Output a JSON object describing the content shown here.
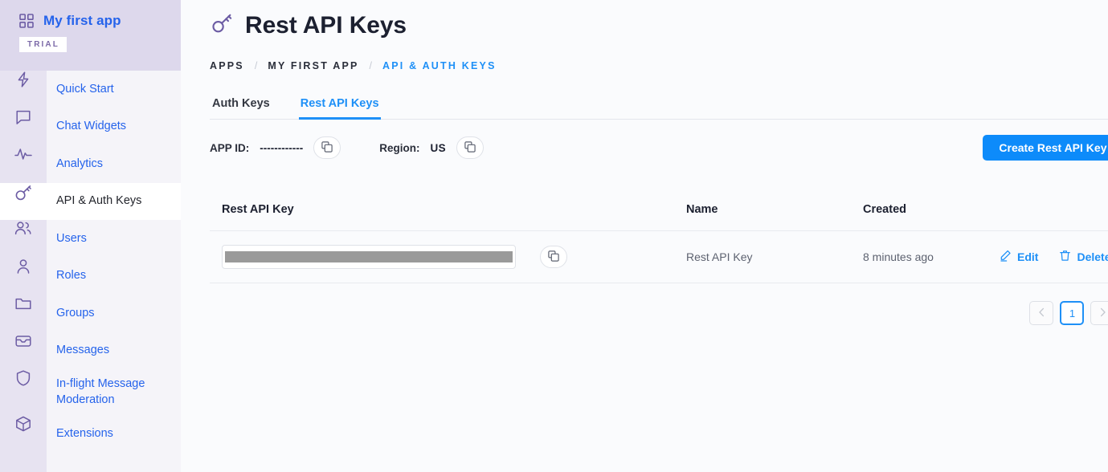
{
  "sidebar": {
    "app_name": "My first app",
    "badge": "TRIAL",
    "items": [
      {
        "label": "Quick Start",
        "icon": "bolt-icon"
      },
      {
        "label": "Chat Widgets",
        "icon": "chat-bubble-icon"
      },
      {
        "label": "Analytics",
        "icon": "activity-pulse-icon"
      },
      {
        "label": "API & Auth Keys",
        "icon": "key-icon"
      },
      {
        "label": "Users",
        "icon": "users-icon"
      },
      {
        "label": "Roles",
        "icon": "user-icon"
      },
      {
        "label": "Groups",
        "icon": "folder-icon"
      },
      {
        "label": "Messages",
        "icon": "inbox-icon"
      },
      {
        "label": "In-flight Message Moderation",
        "icon": "shield-icon"
      },
      {
        "label": "Extensions",
        "icon": "cube-icon"
      }
    ]
  },
  "header": {
    "title": "Rest API Keys",
    "title_icon": "key-icon"
  },
  "breadcrumb": {
    "items": [
      "APPS",
      "MY FIRST APP",
      "API & AUTH KEYS"
    ],
    "separator": "/",
    "current_index": 2
  },
  "tabs": [
    {
      "label": "Auth Keys",
      "active": false
    },
    {
      "label": "Rest API Keys",
      "active": true
    }
  ],
  "meta": {
    "app_id_label": "APP ID:",
    "app_id_value": "------------",
    "app_id_copy_icon": "copy-icon",
    "region_label": "Region:",
    "region_value": "US",
    "region_copy_icon": "copy-icon"
  },
  "actions": {
    "create_button": "Create Rest API Key"
  },
  "table": {
    "columns": [
      "Rest API Key",
      "Name",
      "Created"
    ],
    "rows": [
      {
        "key_value": "",
        "key_redacted": true,
        "copy_icon": "copy-icon",
        "name": "Rest API Key",
        "created": "8 minutes ago",
        "edit_label": "Edit",
        "edit_icon": "pencil-icon",
        "delete_label": "Delete",
        "delete_icon": "trash-icon"
      }
    ]
  },
  "pagination": {
    "prev_icon": "chevron-left-icon",
    "next_icon": "chevron-right-icon",
    "pages": [
      "1"
    ],
    "current_page": "1"
  },
  "colors": {
    "accent_blue": "#1e90f7",
    "button_blue": "#0d8bfa",
    "sidebar_purple": "#ddd8ec",
    "rail_purple": "#e7e3f1",
    "link_blue": "#2563eb",
    "icon_purple": "#6c5ca4",
    "page_bg": "#fafbfd"
  }
}
